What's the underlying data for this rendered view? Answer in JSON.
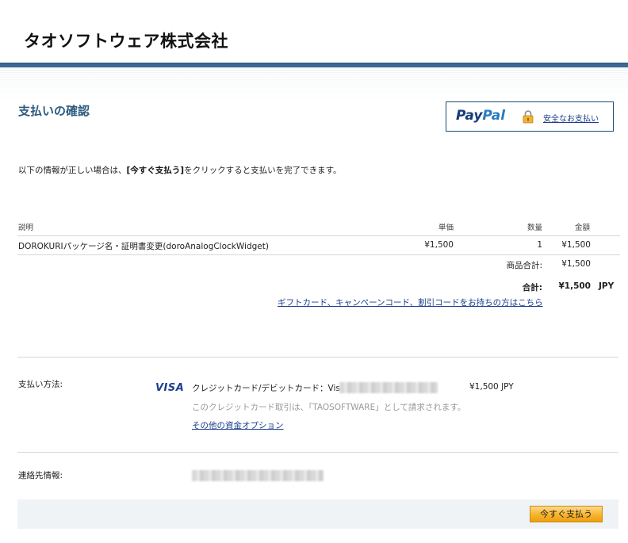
{
  "header": {
    "merchant_name": "タオソフトウェア株式会社"
  },
  "page": {
    "title": "支払いの確認"
  },
  "paypal": {
    "logo_pay": "Pay",
    "logo_pal": "Pal",
    "secure_link": "安全なお支払い"
  },
  "instruction": {
    "prefix": "以下の情報が正しい場合は、",
    "bold": "[今すぐ支払う]",
    "suffix": "をクリックすると支払いを完了できます。"
  },
  "table": {
    "headers": {
      "description": "説明",
      "unit_price": "単価",
      "quantity": "数量",
      "amount": "金額"
    },
    "rows": [
      {
        "description": "DOROKURIパッケージ名・証明書変更(doroAnalogClockWidget)",
        "unit_price": "¥1,500",
        "quantity": "1",
        "amount": "¥1,500"
      }
    ],
    "subtotal_label": "商品合計:",
    "subtotal_value": "¥1,500",
    "total_label": "合計:",
    "total_value": "¥1,500",
    "total_currency": "JPY",
    "gift_link": "ギフトカード、キャンペーンコード、割引コードをお持ちの方はこちら"
  },
  "payment": {
    "label": "支払い方法:",
    "card_brand": "VISA",
    "card_text": "クレジットカード/デビットカード：Visa",
    "amount": "¥1,500 JPY",
    "note": "このクレジットカード取引は、「TAOSOFTWARE」として請求されます。",
    "other_options_link": "その他の資金オプション"
  },
  "contact": {
    "label": "連絡先情報:"
  },
  "footer": {
    "pay_now_button": "今すぐ支払う"
  },
  "colors": {
    "accent": "#3b6896",
    "title": "#2d5a7e",
    "link": "#1a3e8c",
    "button": "#f7b42c"
  }
}
